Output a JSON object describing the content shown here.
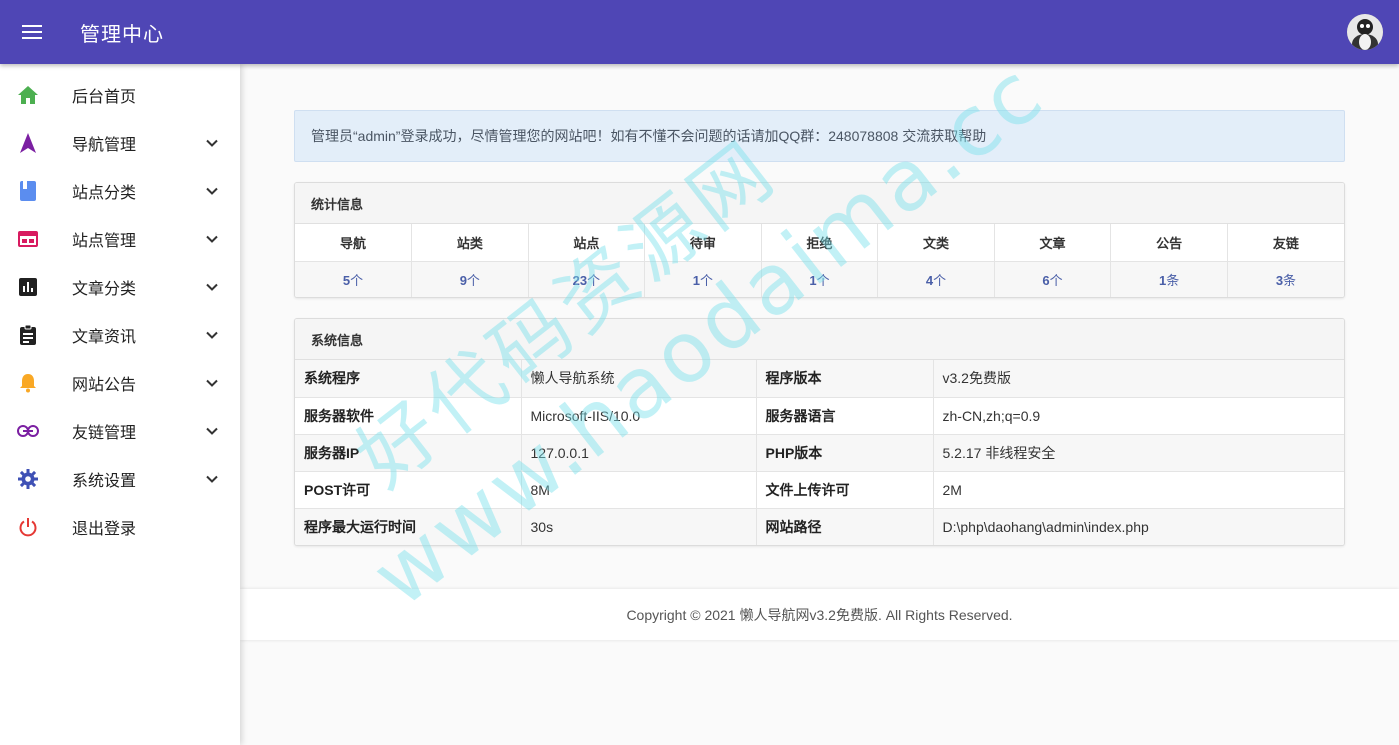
{
  "header": {
    "title": "管理中心",
    "menu_icon": "menu-icon",
    "avatar_icon": "avatar-image"
  },
  "sidebar": {
    "items": [
      {
        "label": "后台首页",
        "icon": "home-icon",
        "color": "#4caf50",
        "expandable": false
      },
      {
        "label": "导航管理",
        "icon": "navigation-arrow-icon",
        "color": "#7b1fa2",
        "expandable": true
      },
      {
        "label": "站点分类",
        "icon": "book-icon",
        "color": "#5b8def",
        "expandable": true
      },
      {
        "label": "站点管理",
        "icon": "web-window-icon",
        "color": "#d81b60",
        "expandable": true
      },
      {
        "label": "文章分类",
        "icon": "bar-chart-icon",
        "color": "#212121",
        "expandable": true
      },
      {
        "label": "文章资讯",
        "icon": "clipboard-icon",
        "color": "#212121",
        "expandable": true
      },
      {
        "label": "网站公告",
        "icon": "bell-icon",
        "color": "#f9a825",
        "expandable": true
      },
      {
        "label": "友链管理",
        "icon": "link-icon",
        "color": "#7b1fa2",
        "expandable": true
      },
      {
        "label": "系统设置",
        "icon": "gear-icon",
        "color": "#3f51b5",
        "expandable": true
      },
      {
        "label": "退出登录",
        "icon": "power-icon",
        "color": "#e53935",
        "expandable": false
      }
    ]
  },
  "alert": {
    "text": "管理员“admin”登录成功，尽情管理您的网站吧！如有不懂不会问题的话请加QQ群：248078808 交流获取帮助"
  },
  "stats": {
    "title": "统计信息",
    "columns": [
      {
        "label": "导航",
        "value": "5",
        "unit": "个"
      },
      {
        "label": "站类",
        "value": "9",
        "unit": "个"
      },
      {
        "label": "站点",
        "value": "23",
        "unit": "个"
      },
      {
        "label": "待审",
        "value": "1",
        "unit": "个"
      },
      {
        "label": "拒绝",
        "value": "1",
        "unit": "个"
      },
      {
        "label": "文类",
        "value": "4",
        "unit": "个"
      },
      {
        "label": "文章",
        "value": "6",
        "unit": "个"
      },
      {
        "label": "公告",
        "value": "1",
        "unit": "条"
      },
      {
        "label": "友链",
        "value": "3",
        "unit": "条"
      }
    ]
  },
  "sysinfo": {
    "title": "系统信息",
    "rows": [
      {
        "k1": "系统程序",
        "v1": "懒人导航系统",
        "k2": "程序版本",
        "v2": "v3.2免费版"
      },
      {
        "k1": "服务器软件",
        "v1": "Microsoft-IIS/10.0",
        "k2": "服务器语言",
        "v2": "zh-CN,zh;q=0.9"
      },
      {
        "k1": "服务器IP",
        "v1": "127.0.0.1",
        "k2": "PHP版本",
        "v2": "5.2.17 非线程安全"
      },
      {
        "k1": "POST许可",
        "v1": "8M",
        "k2": "文件上传许可",
        "v2": "2M"
      },
      {
        "k1": "程序最大运行时间",
        "v1": "30s",
        "k2": "网站路径",
        "v2": "D:\\php\\daohang\\admin\\index.php"
      }
    ]
  },
  "footer": {
    "text": "Copyright © 2021 懒人导航网v3.2免费版. All Rights Reserved."
  },
  "watermark": {
    "line1": "好代码资源网",
    "line2": "www.haodaima.cc"
  },
  "colors": {
    "topbar": "#4f46b5",
    "alert_bg": "#e3eef9",
    "stat_value": "#4a5fa8"
  }
}
